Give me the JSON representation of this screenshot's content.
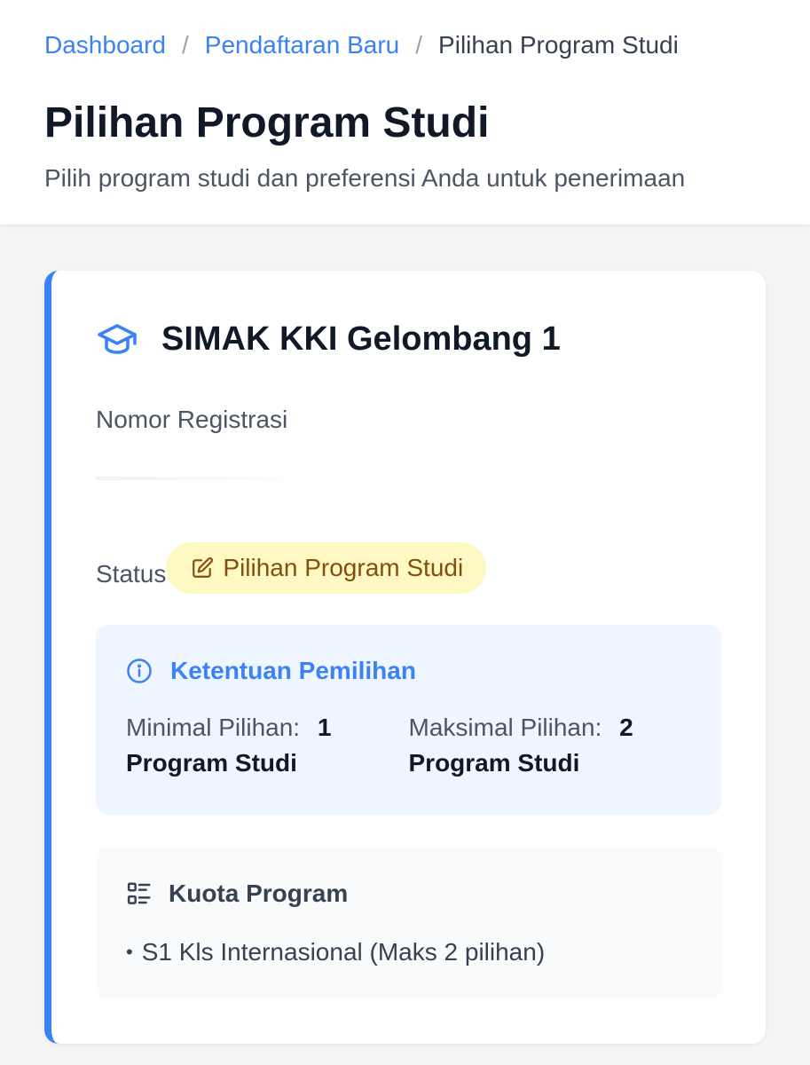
{
  "breadcrumb": {
    "items": [
      "Dashboard",
      "Pendaftaran Baru"
    ],
    "current": "Pilihan Program Studi",
    "separator": "/"
  },
  "header": {
    "title": "Pilihan Program Studi",
    "subtitle": "Pilih program studi dan preferensi Anda untuk penerimaan"
  },
  "card": {
    "title": "SIMAK KKI Gelombang 1",
    "icon": "graduation-cap-icon",
    "registration_label": "Nomor Registrasi",
    "registration_value": "",
    "status_label": "Status",
    "status_badge": "Pilihan Program Studi",
    "status_icon": "edit-icon",
    "rules": {
      "title": "Ketentuan Pemilihan",
      "icon": "info-icon",
      "min_label": "Minimal Pilihan:",
      "min_value": "1",
      "min_unit": "Program Studi",
      "max_label": "Maksimal Pilihan:",
      "max_value": "2",
      "max_unit": "Program Studi"
    },
    "quota": {
      "title": "Kuota Program",
      "icon": "list-icon",
      "items": [
        "S1 Kls Internasional (Maks 2 pilihan)"
      ]
    }
  },
  "colors": {
    "accent": "#3b82f6",
    "badge_bg": "#fef9c3",
    "badge_text": "#854d0e",
    "rules_bg": "#eff6ff"
  }
}
